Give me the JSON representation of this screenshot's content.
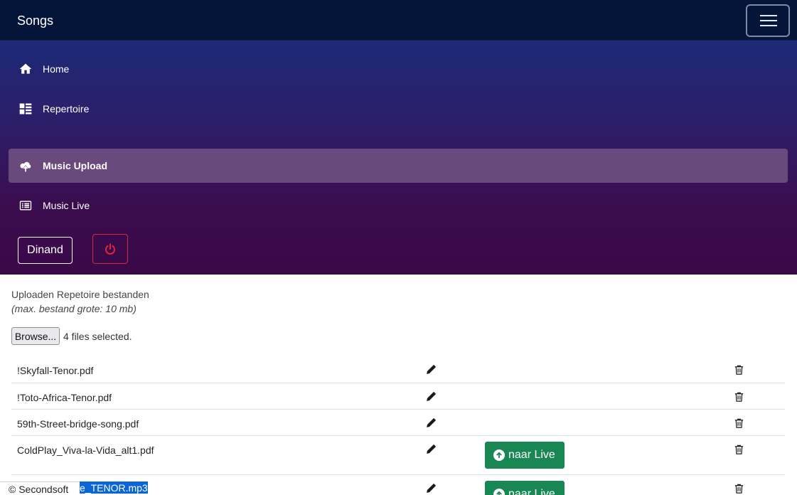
{
  "header": {
    "brand": "Songs",
    "menu_icon": "hamburger-menu-icon"
  },
  "sidebar": {
    "items": [
      {
        "label": "Home",
        "icon": "home-icon",
        "active": false
      },
      {
        "label": "Repertoire",
        "icon": "dashboard-icon",
        "active": false
      },
      {
        "label": "Music Upload",
        "icon": "cloud-upload-icon",
        "active": true
      },
      {
        "label": "Music Live",
        "icon": "list-icon",
        "active": false
      }
    ],
    "user_label": "Dinand",
    "power_icon": "power-icon"
  },
  "upload": {
    "title": "Uploaden Repetoire bestanden",
    "note": "(max. bestand grote: 10 mb)",
    "browse_label": "Browse...",
    "files_selected": "4 files selected."
  },
  "files": [
    {
      "name": "!Skyfall-Tenor.pdf",
      "live_label": ""
    },
    {
      "name": "!Toto-Africa-Tenor.pdf",
      "live_label": ""
    },
    {
      "name": "59th-Street-bridge-song.pdf",
      "live_label": ""
    },
    {
      "name": "ColdPlay_Viva-la-Vida_alt1.pdf",
      "live_label": "naar Live"
    },
    {
      "name": "e_TENOR.mp3",
      "live_label": "naar Live"
    }
  ],
  "footer": {
    "copyright": "© Secondsoft"
  },
  "colors": {
    "navbar": "#051539",
    "active_item": "#6a4a7c",
    "live_button": "#198754",
    "power": "#d12b3a",
    "selection": "#0a66d6"
  }
}
